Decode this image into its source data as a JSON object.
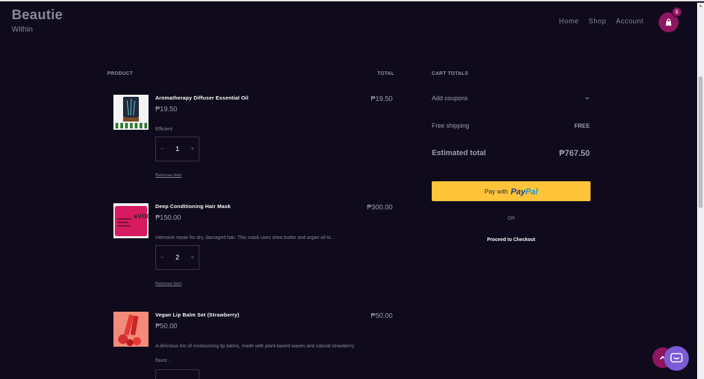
{
  "header": {
    "brand_title": "Beautie",
    "brand_sub": "Within",
    "nav": [
      "Home",
      "Shop",
      "Account"
    ],
    "cart_count": "6"
  },
  "table": {
    "col_product": "PRODUCT",
    "col_total": "TOTAL"
  },
  "items": [
    {
      "name": "Aromatherapy Diffuser Essential Oil",
      "price": "₱19.50",
      "desc": "Efficient",
      "qty": "1",
      "remove": "Remove item",
      "total": "₱19.50"
    },
    {
      "name": "Deep Conditioning Hair Mask",
      "price": "₱150.00",
      "desc": "Intensive repair for dry, damaged hair. This mask uses shea butter and argan oil to...",
      "qty": "2",
      "remove": "Remove item",
      "total": "₱300.00",
      "thumb_label": "eVOO"
    },
    {
      "name": "Vegan Lip Balm Set (Strawberry)",
      "price": "₱50.00",
      "desc": "A delicious trio of moisturizing lip balms, made with plant-based waxes and natural strawberry flavor...",
      "total": "₱50.00"
    }
  ],
  "cart_totals": {
    "heading": "CART TOTALS",
    "coupons": "Add coupons",
    "shipping_label": "Free shipping",
    "shipping_value": "FREE",
    "estimated_label": "Estimated total",
    "estimated_value": "₱767.50",
    "paypal_prefix": "Pay with",
    "paypal_brand_a": "Pay",
    "paypal_brand_b": "Pal",
    "or": "OR",
    "checkout": "Proceed to Checkout"
  },
  "qty_controls": {
    "minus": "−",
    "plus": "+"
  },
  "colors": {
    "background": "#0f0b1c",
    "accent": "#8e1560",
    "paypal": "#ffc439"
  },
  "icons": [
    "cart-icon",
    "chevron-down-icon",
    "arrow-up-icon",
    "chat-icon"
  ]
}
